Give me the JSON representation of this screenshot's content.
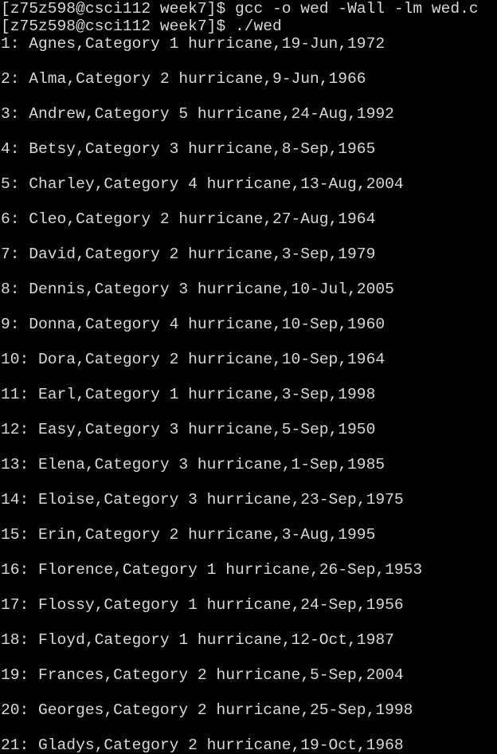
{
  "terminal": {
    "commands": [
      {
        "prompt": "[z75z598@csci112 week7]$",
        "command": "gcc -o wed -Wall -lm wed.c"
      },
      {
        "prompt": "[z75z598@csci112 week7]$",
        "command": "./wed"
      }
    ],
    "output": [
      "1: Agnes,Category 1 hurricane,19-Jun,1972",
      "2: Alma,Category 2 hurricane,9-Jun,1966",
      "3: Andrew,Category 5 hurricane,24-Aug,1992",
      "4: Betsy,Category 3 hurricane,8-Sep,1965",
      "5: Charley,Category 4 hurricane,13-Aug,2004",
      "6: Cleo,Category 2 hurricane,27-Aug,1964",
      "7: David,Category 2 hurricane,3-Sep,1979",
      "8: Dennis,Category 3 hurricane,10-Jul,2005",
      "9: Donna,Category 4 hurricane,10-Sep,1960",
      "10: Dora,Category 2 hurricane,10-Sep,1964",
      "11: Earl,Category 1 hurricane,3-Sep,1998",
      "12: Easy,Category 3 hurricane,5-Sep,1950",
      "13: Elena,Category 3 hurricane,1-Sep,1985",
      "14: Eloise,Category 3 hurricane,23-Sep,1975",
      "15: Erin,Category 2 hurricane,3-Aug,1995",
      "16: Florence,Category 1 hurricane,26-Sep,1953",
      "17: Flossy,Category 1 hurricane,24-Sep,1956",
      "18: Floyd,Category 1 hurricane,12-Oct,1987",
      "19: Frances,Category 2 hurricane,5-Sep,2004",
      "20: Georges,Category 2 hurricane,25-Sep,1998",
      "21: Gladys,Category 2 hurricane,19-Oct,1968"
    ],
    "colors": {
      "background": "#000000",
      "text": "#d9d9d9"
    }
  }
}
